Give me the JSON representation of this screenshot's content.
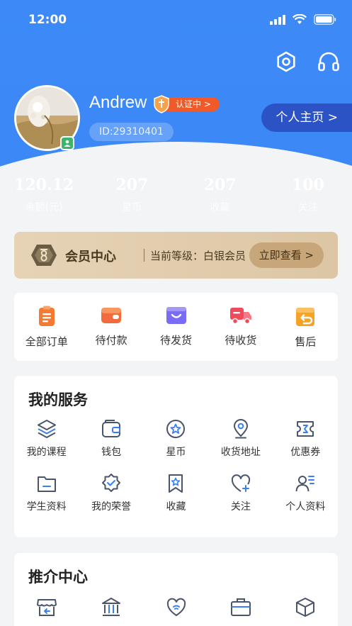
{
  "status": {
    "time": "12:00"
  },
  "top_actions": {
    "settings_icon": "settings-hexagon-icon",
    "support_icon": "headphones-icon"
  },
  "profile": {
    "username": "Andrew",
    "verify_status": "认证中 >",
    "user_id": "ID:29310401",
    "homepage_button": "个人主页 >"
  },
  "stats": [
    {
      "value": "120.12",
      "label": "余额(元)"
    },
    {
      "value": "207",
      "label": "星币"
    },
    {
      "value": "207",
      "label": "收藏"
    },
    {
      "value": "100",
      "label": "关注"
    }
  ],
  "member": {
    "title": "会员中心",
    "level": "当前等级：白银会员",
    "button": "立即查看 >"
  },
  "orders": [
    {
      "label": "全部订单",
      "icon": "clipboard-icon",
      "color": "#f47a33"
    },
    {
      "label": "待付款",
      "icon": "wallet-icon",
      "color": "#f26b3d"
    },
    {
      "label": "待发货",
      "icon": "bag-icon",
      "color": "#7b6cf6"
    },
    {
      "label": "待收货",
      "icon": "truck-icon",
      "color": "#ef4b5a"
    },
    {
      "label": "售后",
      "icon": "return-icon",
      "color": "#f7a325"
    }
  ],
  "services": {
    "title": "我的服务",
    "items": [
      {
        "label": "我的课程",
        "icon": "layers-icon"
      },
      {
        "label": "钱包",
        "icon": "wallet-outline-icon"
      },
      {
        "label": "星币",
        "icon": "star-coin-icon"
      },
      {
        "label": "收货地址",
        "icon": "location-pin-icon"
      },
      {
        "label": "优惠券",
        "icon": "coupon-icon"
      },
      {
        "label": "学生资料",
        "icon": "folder-icon"
      },
      {
        "label": "我的荣誉",
        "icon": "badge-check-icon"
      },
      {
        "label": "收藏",
        "icon": "bookmark-star-icon"
      },
      {
        "label": "关注",
        "icon": "heart-plus-icon"
      },
      {
        "label": "个人资料",
        "icon": "user-list-icon"
      }
    ]
  },
  "recommend": {
    "title": "推介中心",
    "items": [
      {
        "icon": "store-icon"
      },
      {
        "icon": "bank-icon"
      },
      {
        "icon": "heart-wifi-icon"
      },
      {
        "icon": "briefcase-icon"
      },
      {
        "icon": "cube-icon"
      }
    ]
  },
  "colors": {
    "primary": "#3a86f6",
    "accent_blue": "#3a7ff0",
    "icon_gray": "#4a5568",
    "verify_orange": "#f05a28",
    "homepage_btn": "#2c53c5",
    "gold": "#dcc6a4"
  }
}
